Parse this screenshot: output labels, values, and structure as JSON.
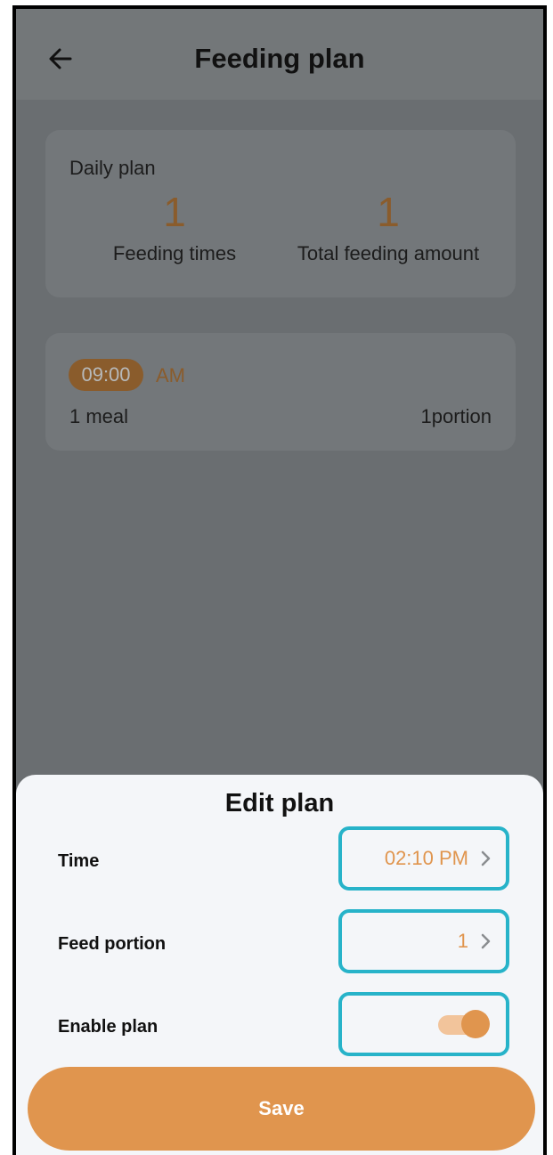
{
  "header": {
    "title": "Feeding plan",
    "back_icon": "arrow-left-icon"
  },
  "daily_plan": {
    "label": "Daily plan",
    "feeding_times_value": "1",
    "feeding_times_label": "Feeding times",
    "total_amount_value": "1",
    "total_amount_label": "Total feeding amount"
  },
  "meal": {
    "time": "09:00",
    "ampm": "AM",
    "count_label": "1 meal",
    "portion_label": "1portion"
  },
  "edit_sheet": {
    "title": "Edit plan",
    "time_label": "Time",
    "time_value": "02:10 PM",
    "portion_label": "Feed portion",
    "portion_value": "1",
    "enable_label": "Enable plan",
    "enabled": true,
    "save_label": "Save"
  },
  "colors": {
    "accent": "#e0954e",
    "highlight_border": "#27b3c9",
    "overlay_text_accent": "#8a5c2c"
  }
}
